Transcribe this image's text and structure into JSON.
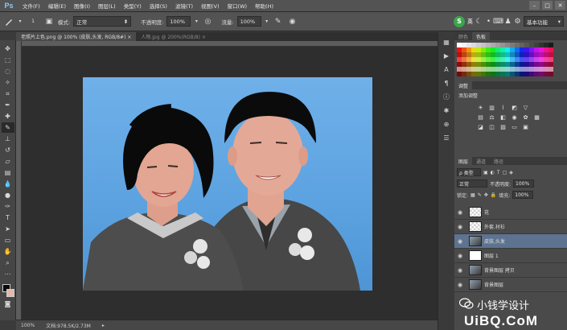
{
  "app": {
    "logo": "Ps"
  },
  "menu": [
    "文件(F)",
    "编辑(E)",
    "图像(I)",
    "图层(L)",
    "类型(Y)",
    "选择(S)",
    "滤镜(T)",
    "视图(V)",
    "窗口(W)",
    "帮助(H)"
  ],
  "window_controls": {
    "minimize": "–",
    "maximize": "□",
    "close": "✕"
  },
  "options": {
    "brush_size": "1",
    "mode_label": "模式:",
    "mode_value": "正常",
    "opacity_label": "不透明度:",
    "opacity_value": "100%",
    "flow_label": "流量:",
    "flow_value": "100%",
    "ime_label": "英",
    "workspace": "基本功能"
  },
  "tabs": [
    {
      "label": "老照片上色.png @ 100% (皮肤,头发, RGB/8#) ×",
      "active": true
    },
    {
      "label": "人物.jpg @ 200%(RGB/8) ×",
      "active": false
    }
  ],
  "status": {
    "zoom": "100%",
    "doc": "文档:978.5K/2.73M"
  },
  "colors": {
    "accent": "#5d7390",
    "canvas_bg": "#2e2e2e",
    "photo_bg": "#5ca2e0"
  },
  "swatch_panel": {
    "tabs": [
      "颜色",
      "色板"
    ],
    "active": 1
  },
  "adjust_panel": {
    "tab": "调整",
    "title": "添加调整"
  },
  "layers_panel": {
    "tabs": [
      "图层",
      "通道",
      "路径"
    ],
    "filter_label": "ρ 类型",
    "blend_mode": "正常",
    "opacity_label": "不透明度:",
    "opacity_value": "100%",
    "lock_label": "锁定:",
    "fill_label": "填充:",
    "fill_value": "100%",
    "layers": [
      {
        "name": "花",
        "thumb": "check",
        "selected": false
      },
      {
        "name": "外套,衬衫",
        "thumb": "check",
        "selected": false
      },
      {
        "name": "皮肤,头发",
        "thumb": "photo",
        "selected": true
      },
      {
        "name": "图层 1",
        "thumb": "mask",
        "selected": false
      },
      {
        "name": "背景图层 拷贝",
        "thumb": "photo",
        "selected": false
      },
      {
        "name": "背景图层",
        "thumb": "photo",
        "selected": false
      }
    ]
  },
  "watermark": {
    "text": "小钱学设计",
    "brand": "UiBQ.CoM"
  }
}
